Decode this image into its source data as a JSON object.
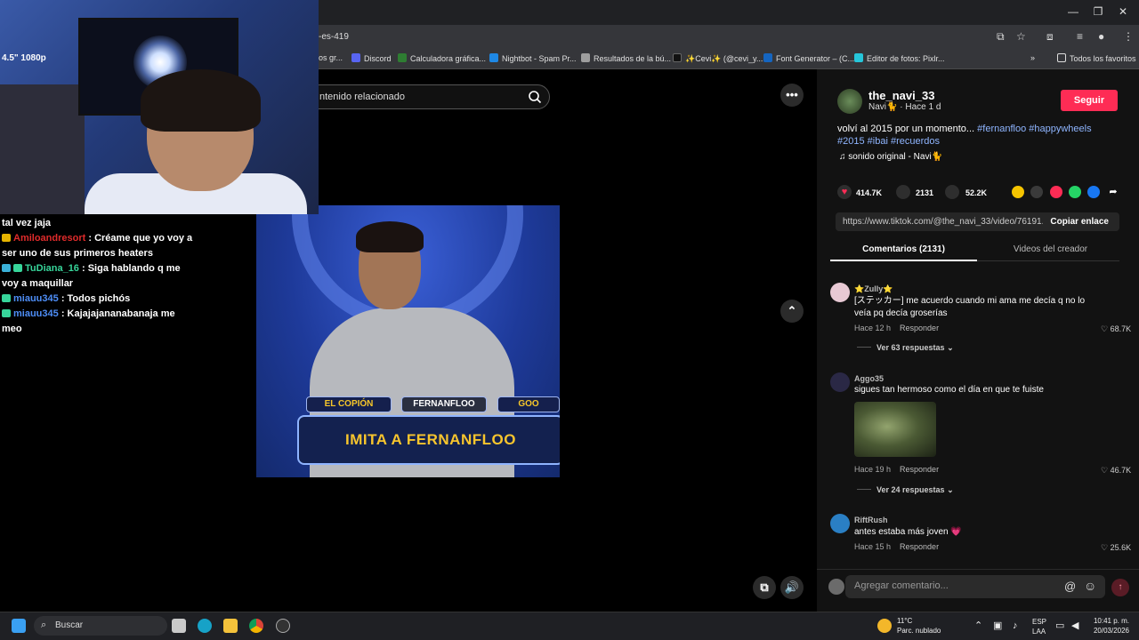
{
  "browser": {
    "url_fragment": "-es-419",
    "bookmarks": [
      {
        "label": "os gr...",
        "color": "#8a8a8a"
      },
      {
        "label": "Discord",
        "color": "#5865f2"
      },
      {
        "label": "Calculadora gráfica...",
        "color": "#2e7d32"
      },
      {
        "label": "Nightbot - Spam Pr...",
        "color": "#1e88e5"
      },
      {
        "label": "Resultados de la bú...",
        "color": "#9e9e9e"
      },
      {
        "label": "✨Cevi✨ (@cevi_y...",
        "color": "#111111"
      },
      {
        "label": "Font Generator – (C...",
        "color": "#1565c0"
      },
      {
        "label": "Editor de fotos: Pixlr...",
        "color": "#26c6da"
      }
    ],
    "all_favorites": "Todos los favoritos"
  },
  "webcam": {
    "overlay_text": "4.5\" 1080p"
  },
  "chat": {
    "lines": [
      {
        "user": "",
        "text": "tal vez jaja",
        "color": "#ffffff"
      },
      {
        "user": "Amiloandresort",
        "text": ": Créame que yo voy a ser uno de sus primeros heaters",
        "color": "#e02b2b"
      },
      {
        "user": "TuDiana_16",
        "text": ": Siga hablando q me voy a maquillar",
        "color": "#37d59a"
      },
      {
        "user": "miauu345",
        "text": ": Todos pichós",
        "color": "#4e8ef7"
      },
      {
        "user": "miauu345",
        "text": ": Kajajajananabanaja me meo",
        "color": "#4e8ef7"
      }
    ]
  },
  "search": {
    "placeholder": "ntenido relacionado"
  },
  "video": {
    "labels": [
      "EL COPIÓN",
      "FERNANFLOO",
      "GOO"
    ],
    "banner": "IMITA A FERNANFLOO"
  },
  "post": {
    "author": "the_navi_33",
    "author_sub": "Navi🐈",
    "time": "Hace 1 d",
    "follow": "Seguir",
    "description": "volví al 2015 por un momento...",
    "tags": [
      "#fernanfloo",
      "#happywheels",
      "#2015",
      "#ibai",
      "#recuerdos"
    ],
    "sound": "sonido original - Navi🐈",
    "likes": "414.7K",
    "comments": "2131",
    "saves": "52.2K",
    "link": "https://www.tiktok.com/@the_navi_33/video/76191...",
    "copy_link": "Copiar enlace"
  },
  "tabs": {
    "comments": "Comentarios (2131)",
    "creator_videos": "Videos del creador"
  },
  "comments": [
    {
      "name": "⭐Zully⭐",
      "text": "[ステッカー] me acuerdo cuando mi ama me decía q no lo veía pq decía groserías",
      "time": "Hace 12 h",
      "reply": "Responder",
      "likes": "68.7K",
      "more": "Ver 63 respuestas"
    },
    {
      "name": "Aggo35",
      "text": "sigues tan hermoso como el día en que te fuiste",
      "time": "Hace 19 h",
      "reply": "Responder",
      "likes": "46.7K",
      "more": "Ver 24 respuestas"
    },
    {
      "name": "RiftRush",
      "text": "antes estaba más joven 💗",
      "time": "Hace 15 h",
      "reply": "Responder",
      "likes": "25.6K"
    }
  ],
  "comment_input": {
    "placeholder": "Agregar comentario..."
  },
  "taskbar": {
    "search": "Buscar",
    "weather_temp": "11°C",
    "weather_desc": "Parc. nublado",
    "lang_1": "ESP",
    "lang_2": "LAA",
    "time": "10:41 p. m.",
    "date": "20/03/2026"
  },
  "colors": {
    "accent": "#fe2c55",
    "tag": "#8fb5ff",
    "panel": "#121212"
  }
}
